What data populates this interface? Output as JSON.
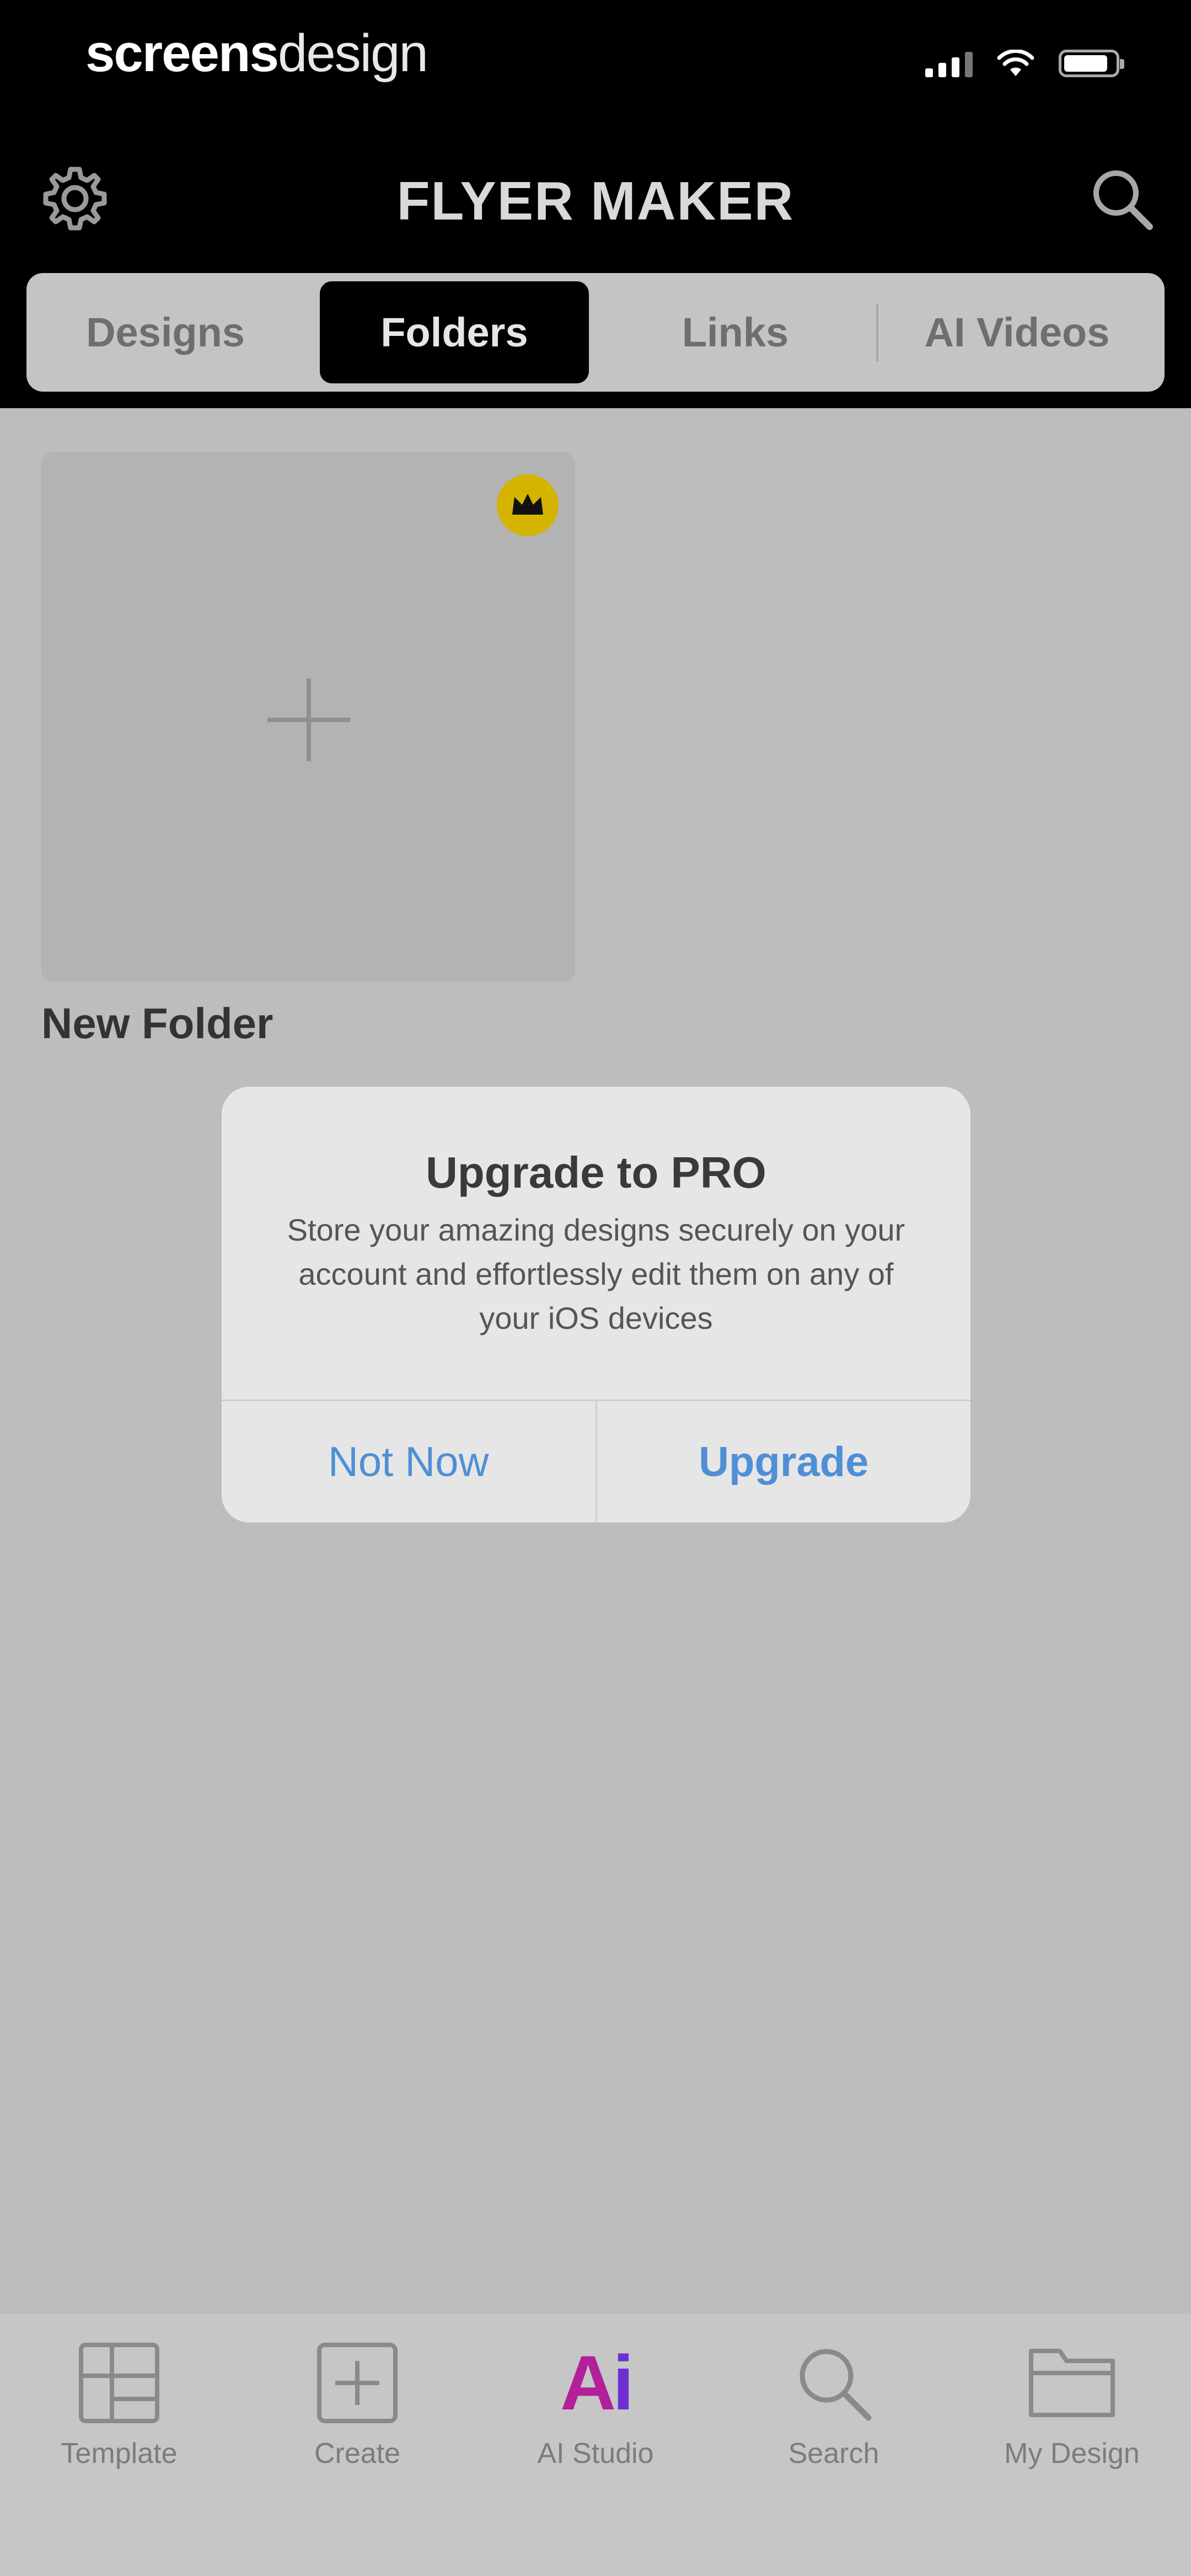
{
  "status_bar": {
    "brand_bold": "screens",
    "brand_light": "design"
  },
  "header": {
    "title": "FLYER MAKER",
    "settings_icon": "gear-icon",
    "search_icon": "search-icon"
  },
  "segments": [
    {
      "label": "Designs",
      "active": false
    },
    {
      "label": "Folders",
      "active": true
    },
    {
      "label": "Links",
      "active": false
    },
    {
      "label": "AI Videos",
      "active": false
    }
  ],
  "folders": {
    "new_folder_label": "New Folder",
    "premium_icon": "crown-icon",
    "premium_color": "#d4b400"
  },
  "alert": {
    "title": "Upgrade to PRO",
    "message": "Store your amazing designs securely on your account and effortlessly edit them on any of your iOS devices",
    "cancel_label": "Not Now",
    "confirm_label": "Upgrade",
    "button_color": "#4f8fd6"
  },
  "tabbar": [
    {
      "label": "Template",
      "icon": "template-icon"
    },
    {
      "label": "Create",
      "icon": "create-plus-icon"
    },
    {
      "label": "AI Studio",
      "icon": "ai-studio-icon"
    },
    {
      "label": "Search",
      "icon": "search-icon"
    },
    {
      "label": "My Design",
      "icon": "folder-icon"
    }
  ]
}
